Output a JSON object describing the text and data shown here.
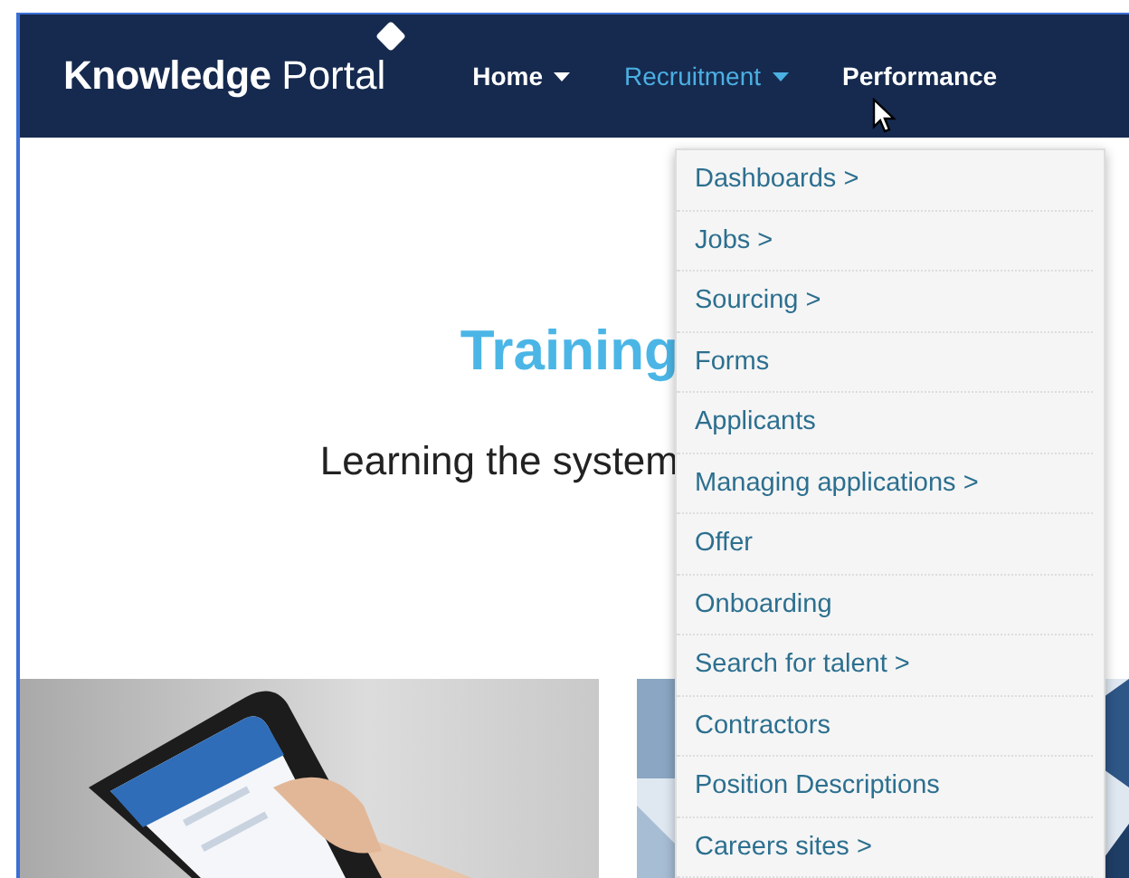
{
  "header": {
    "logo": {
      "bold": "Knowledge",
      "light": "Portal"
    },
    "nav": [
      {
        "label": "Home",
        "selected": false,
        "dropdown": true
      },
      {
        "label": "Recruitment",
        "selected": true,
        "dropdown": true
      },
      {
        "label": "Performance",
        "selected": false,
        "dropdown": false
      }
    ]
  },
  "hero": {
    "title": "Training",
    "subtitle": "Learning the system"
  },
  "menu": {
    "items": [
      "Dashboards >",
      "Jobs >",
      "Sourcing >",
      "Forms",
      "Applicants",
      "Managing applications >",
      "Offer",
      "Onboarding",
      "Search for talent >",
      "Contractors",
      "Position Descriptions",
      "Careers sites >"
    ]
  }
}
